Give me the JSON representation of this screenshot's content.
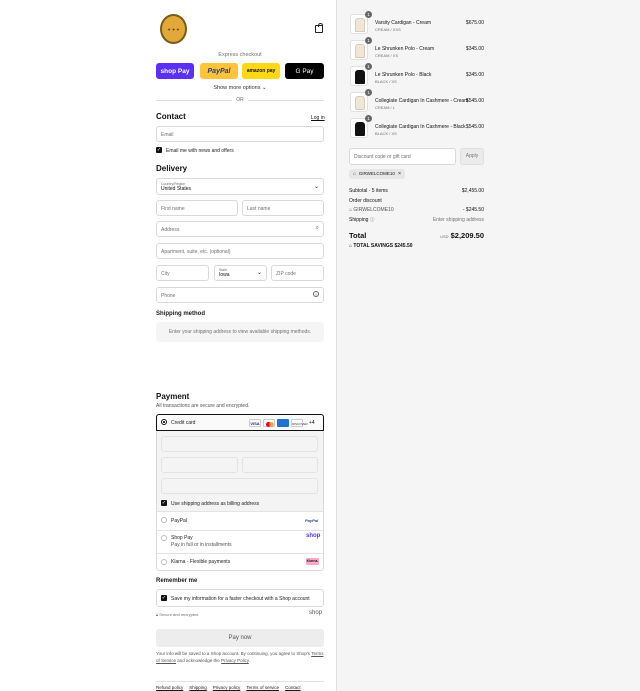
{
  "checkout": {
    "express_label": "Express checkout",
    "shop_pay": "shop Pay",
    "paypal": "PayPal",
    "amazon_pay": "amazon pay",
    "google_pay": "G Pay",
    "show_more": "Show more options",
    "or": "OR"
  },
  "contact": {
    "title": "Contact",
    "login": "Log in",
    "email_placeholder": "Email",
    "news_label": "Email me with news and offers"
  },
  "delivery": {
    "title": "Delivery",
    "country_label": "Country/Region",
    "country_value": "United States",
    "first_name": "First name",
    "last_name": "Last name",
    "address": "Address",
    "apartment": "Apartment, suite, etc. (optional)",
    "city": "City",
    "state_label": "State",
    "state_value": "Iowa",
    "zip": "ZIP code",
    "phone": "Phone"
  },
  "shipping_method": {
    "title": "Shipping method",
    "notice": "Enter your shipping address to view available shipping methods."
  },
  "payment": {
    "title": "Payment",
    "subtitle": "All transactions are secure and encrypted.",
    "credit_card": "Credit card",
    "more_cards": "+4",
    "billing_label": "Use shipping address as billing address",
    "paypal": "PayPal",
    "paypal_logo": "PayPal",
    "shoppay": "Shop Pay",
    "shoppay_sub": "Pay in full or in installments",
    "shoppay_logo": "shop",
    "klarna": "Klarna - Flexible payments",
    "klarna_logo": "Klarna."
  },
  "remember": {
    "title": "Remember me",
    "save_label": "Save my information for a faster checkout with a Shop account",
    "secure": "Secure and encrypted",
    "shop_logo": "shop"
  },
  "pay_now": "Pay now",
  "disclaimer": {
    "prefix": "Your info will be saved to a Shop account. By continuing, you agree to Shop's",
    "terms": "Terms of Service",
    "and": "and acknowledge the",
    "privacy": "Privacy Policy",
    "suffix": "."
  },
  "footer": [
    "Refund policy",
    "Shipping",
    "Privacy policy",
    "Terms of service",
    "Contact"
  ],
  "cart": {
    "items": [
      {
        "qty": "1",
        "name": "Varsity Cardigan - Cream",
        "variant": "CREAM / XXS",
        "price": "$675.00",
        "color": "#efe6d8"
      },
      {
        "qty": "1",
        "name": "Le Shrunken Polo - Cream",
        "variant": "CREAM / XS",
        "price": "$345.00",
        "color": "#efe6d8"
      },
      {
        "qty": "1",
        "name": "Le Shrunken Polo - Black",
        "variant": "BLACK / XS",
        "price": "$345.00",
        "color": "#111111"
      },
      {
        "qty": "1",
        "name": "Collegiate Cardigan In Cashmere - Cream",
        "variant": "CREAM / L",
        "price": "$545.00",
        "color": "#efe6d8"
      },
      {
        "qty": "1",
        "name": "Collegiate Cardigan In Cashmere - Black",
        "variant": "BLACK / XS",
        "price": "$545.00",
        "color": "#111111"
      }
    ],
    "discount_placeholder": "Discount code or gift card",
    "apply": "Apply",
    "applied_code": "GIRWELCOME10",
    "subtotal_label": "Subtotal · 5 items",
    "subtotal_value": "$2,455.00",
    "order_discount": "Order discount",
    "discount_code": "GIRWELCOME10",
    "discount_value": "- $245.50",
    "shipping_label": "Shipping",
    "shipping_value": "Enter shipping address",
    "total_label": "Total",
    "currency": "USD",
    "total_value": "$2,209.50",
    "savings_label": "TOTAL SAVINGS",
    "savings_value": "$245.50"
  }
}
